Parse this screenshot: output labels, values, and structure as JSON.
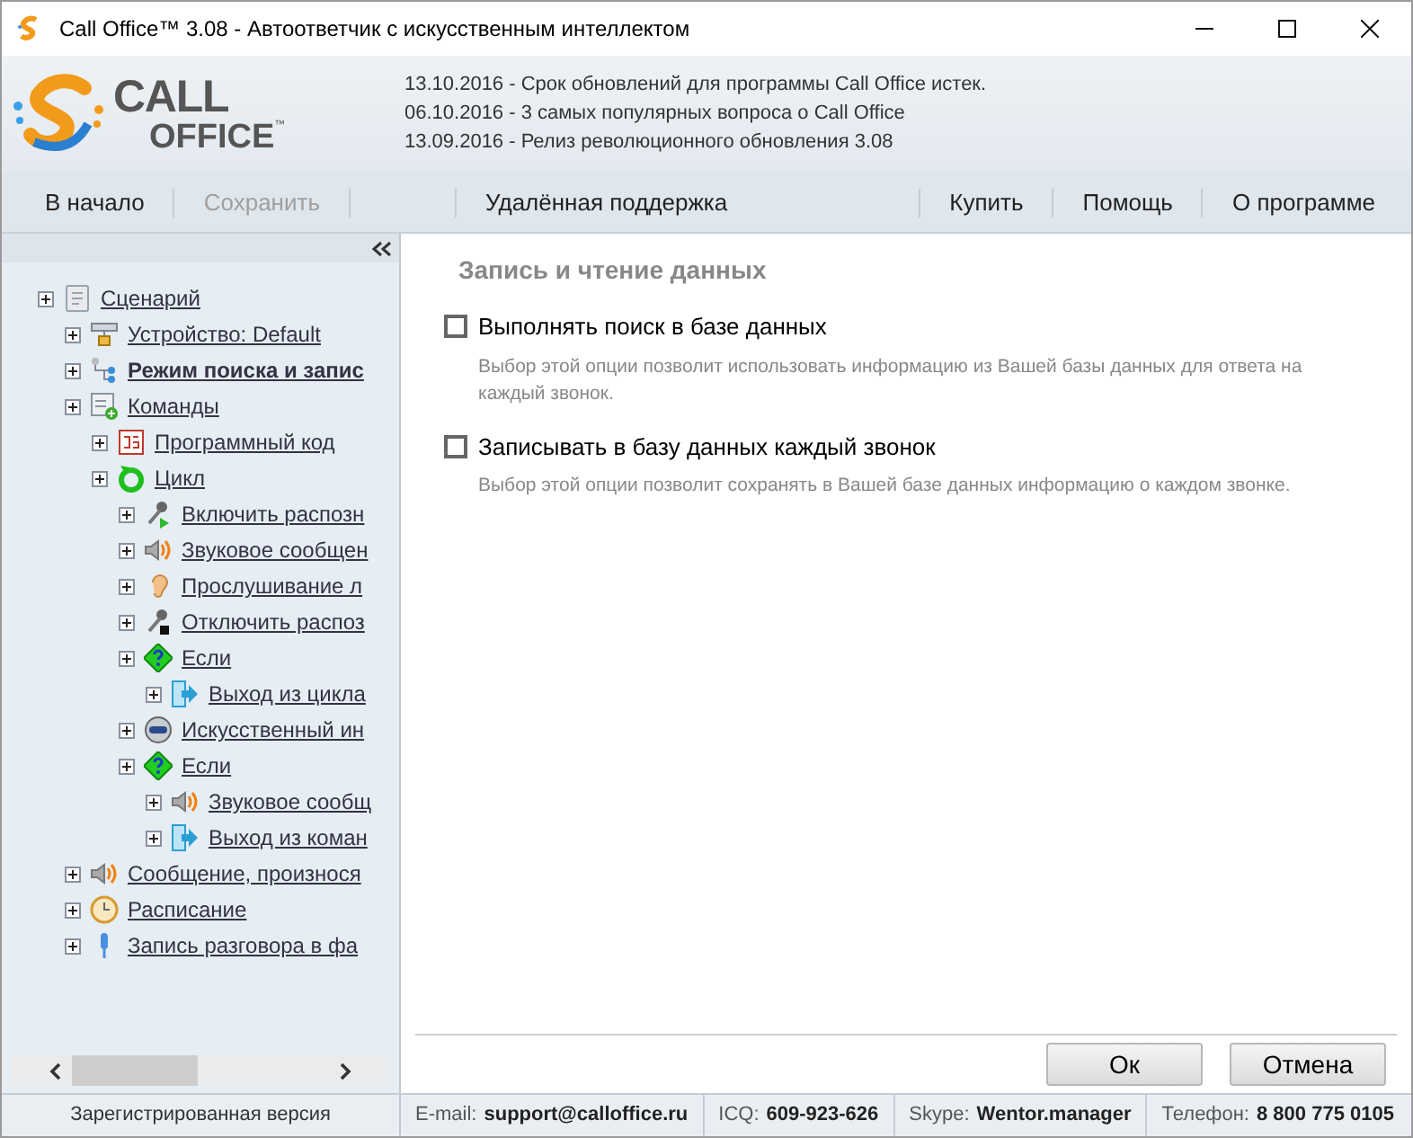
{
  "window": {
    "title": "Call Office™ 3.08 - Автоответчик с искусственным интеллектом"
  },
  "logo": {
    "line1": "CALL",
    "line2": "OFFICE",
    "mark": "™"
  },
  "news": [
    "13.10.2016 - Срок обновлений для программы Call Office истек.",
    "06.10.2016 - 3 самых популярных вопроса о Call Office",
    "13.09.2016 - Релиз революционного обновления 3.08"
  ],
  "toolbar": {
    "left": [
      {
        "label": "В начало",
        "disabled": false
      },
      {
        "label": "Сохранить",
        "disabled": true
      }
    ],
    "center": [
      {
        "label": "Удалённая поддержка",
        "disabled": false
      }
    ],
    "right": [
      {
        "label": "Купить",
        "disabled": false
      },
      {
        "label": "Помощь",
        "disabled": false
      },
      {
        "label": "О программе",
        "disabled": false
      }
    ]
  },
  "tree": [
    {
      "label": "Сценарий",
      "kind": "scenario",
      "selected": false,
      "children": [
        {
          "label": "Устройство: Default",
          "kind": "device",
          "selected": false
        },
        {
          "label": "Режим поиска и запис",
          "kind": "search-mode",
          "selected": true
        },
        {
          "label": "Команды",
          "kind": "commands",
          "selected": false,
          "children": [
            {
              "label": "Программный код",
              "kind": "code",
              "selected": false
            },
            {
              "label": "Цикл",
              "kind": "loop",
              "selected": false,
              "children": [
                {
                  "label": "Включить распозн",
                  "kind": "mic-on",
                  "selected": false
                },
                {
                  "label": "Звуковое сообщен",
                  "kind": "speaker",
                  "selected": false
                },
                {
                  "label": "Прослушивание л",
                  "kind": "ear",
                  "selected": false
                },
                {
                  "label": "Отключить распоз",
                  "kind": "mic-off",
                  "selected": false
                },
                {
                  "label": "Если",
                  "kind": "question",
                  "selected": false,
                  "children": [
                    {
                      "label": "Выход из цикла",
                      "kind": "exit",
                      "selected": false
                    }
                  ]
                },
                {
                  "label": "Искусственный ин",
                  "kind": "robot",
                  "selected": false
                },
                {
                  "label": "Если",
                  "kind": "question",
                  "selected": false,
                  "children": [
                    {
                      "label": "Звуковое сообщ",
                      "kind": "speaker",
                      "selected": false
                    },
                    {
                      "label": "Выход из коман",
                      "kind": "exit",
                      "selected": false
                    }
                  ]
                }
              ]
            }
          ]
        },
        {
          "label": "Сообщение, произнося",
          "kind": "speaker",
          "selected": false
        },
        {
          "label": "Расписание",
          "kind": "clock",
          "selected": false
        },
        {
          "label": "Запись разговора в фа",
          "kind": "microphone",
          "selected": false
        }
      ]
    }
  ],
  "panel": {
    "title": "Запись и чтение данных",
    "options": [
      {
        "label": "Выполнять поиск в базе данных",
        "checked": false,
        "description": "Выбор этой опции позволит использовать информацию из Вашей базы данных для ответа на каждый звонок."
      },
      {
        "label": "Записывать в базу данных каждый звонок",
        "checked": false,
        "description": "Выбор этой опции позволит сохранять в Вашей базе данных информацию о каждом звонке."
      }
    ]
  },
  "buttons": [
    "Ок",
    "Отмена"
  ],
  "status_bar": {
    "version": "Зарегистрированная версия",
    "contacts": [
      {
        "label": "E-mail:",
        "value": "support@calloffice.ru"
      },
      {
        "label": "ICQ:",
        "value": "609-923-626"
      },
      {
        "label": "Skype:",
        "value": "Wentor.manager"
      },
      {
        "label": "Телефон:",
        "value": "8 800 775 0105"
      }
    ]
  }
}
